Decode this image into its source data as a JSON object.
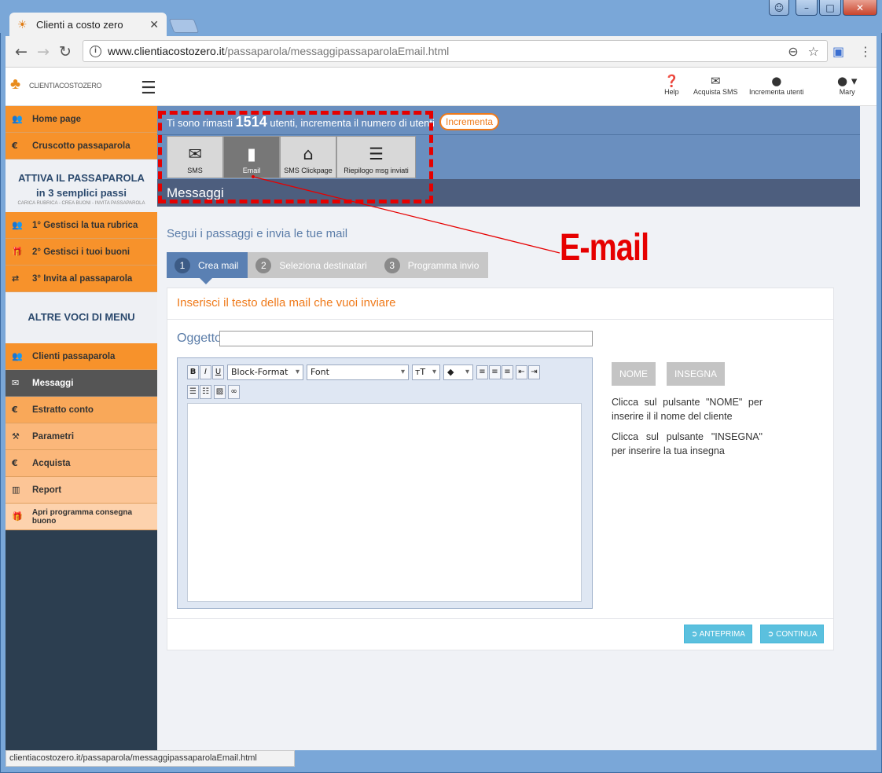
{
  "browser": {
    "tab_title": "Clienti a costo zero",
    "url_host": "www.clientiacostozero.it",
    "url_path": "/passaparola/messaggipassaparolaEmail.html",
    "status_url": "clientiacostozero.it/passaparola/messaggipassaparolaEmail.html"
  },
  "header": {
    "logo_text": "CLIENTIACOSTOZERO",
    "items": [
      {
        "label": "Help",
        "icon": "question-circle-icon"
      },
      {
        "label": "Acquista SMS",
        "icon": "envelope-icon"
      },
      {
        "label": "Incrementa utenti",
        "icon": "user-icon"
      },
      {
        "label": "Mary",
        "icon": "user-dropdown-icon"
      }
    ]
  },
  "sidebar": {
    "items": [
      {
        "label": "Home page",
        "icon": "users-icon"
      },
      {
        "label": "Cruscotto passaparola",
        "icon": "euro-icon"
      }
    ],
    "promo_title": "ATTIVA IL PASSAPAROLA",
    "promo_sub": "in 3 semplici passi",
    "promo_small": "CARICA RUBRICA - CREA BUONI - INVITA PASSAPAROLA",
    "steps": [
      {
        "label": "1°  Gestisci la tua rubrica",
        "icon": "users-icon"
      },
      {
        "label": "2°  Gestisci i tuoi buoni",
        "icon": "gift-icon"
      },
      {
        "label": "3°  Invita al passaparola",
        "icon": "exchange-icon"
      }
    ],
    "other_title": "ALTRE VOCI DI MENU",
    "other": [
      {
        "label": "Clienti passaparola",
        "icon": "users-icon"
      },
      {
        "label": "Messaggi",
        "icon": "envelope-icon"
      },
      {
        "label": "Estratto conto",
        "icon": "euro-icon"
      },
      {
        "label": "Parametri",
        "icon": "tools-icon"
      },
      {
        "label": "Acquista",
        "icon": "euro-icon"
      },
      {
        "label": "Report",
        "icon": "bar-chart-icon"
      },
      {
        "label": "Apri programma consegna buono",
        "icon": "gift-icon"
      }
    ]
  },
  "banner": {
    "text_before": "Ti sono rimasti",
    "count": "1514",
    "text_after": "utenti, incrementa il numero di utenti",
    "incr_button": "Incrementa",
    "tabs": [
      {
        "label": "SMS",
        "icon": "envelope-icon"
      },
      {
        "label": "Email",
        "icon": "file-icon"
      },
      {
        "label": "SMS Clickpage",
        "icon": "presentation-icon"
      },
      {
        "label": "Riepilogo msg inviati",
        "icon": "document-icon"
      }
    ],
    "section_title": "Messaggi"
  },
  "main": {
    "subtitle": "Segui i passaggi e invia le tue mail",
    "steps": [
      {
        "n": "1",
        "label": "Crea mail"
      },
      {
        "n": "2",
        "label": "Seleziona destinatari"
      },
      {
        "n": "3",
        "label": "Programma invio"
      }
    ],
    "card_title": "Inserisci il testo della mail che vuoi inviare",
    "subject_label": "Oggetto",
    "subject_value": "",
    "editor": {
      "block_format": "Block-Format",
      "font": "Font",
      "size": "тT",
      "bold": "B",
      "italic": "I",
      "underline": "U"
    },
    "nome_button": "NOME",
    "insegna_button": "INSEGNA",
    "nome_help": "Clicca sul pulsante \"NOME\" per inserire il il nome del cliente",
    "insegna_help": "Clicca sul pulsante \"INSEGNA\" per inserire la tua insegna",
    "anteprima_button": "ANTEPRIMA",
    "continua_button": "CONTINUA"
  },
  "annotation": {
    "text": "E-mail",
    "color": "#e60000"
  }
}
